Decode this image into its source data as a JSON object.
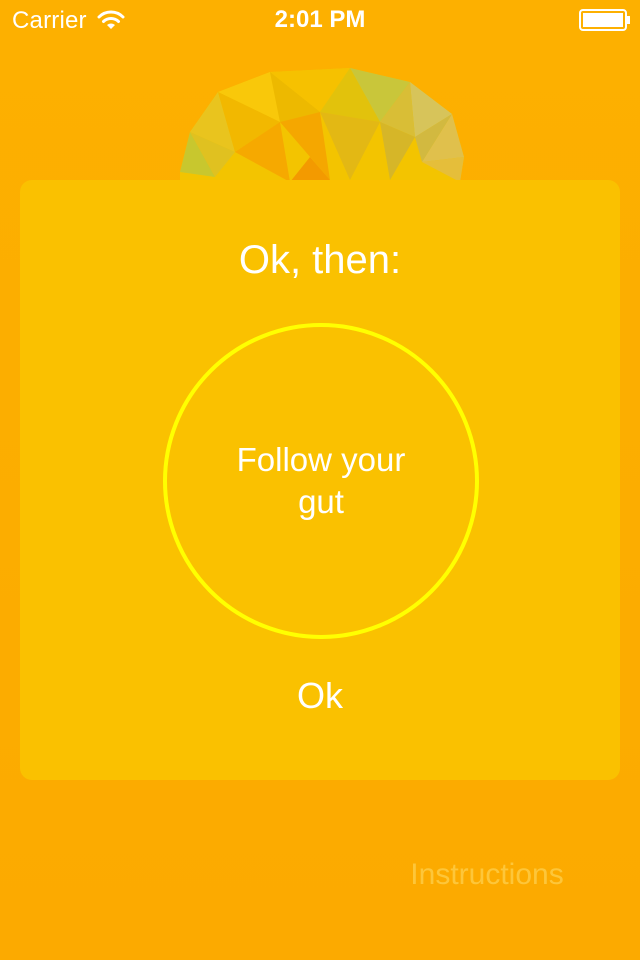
{
  "status_bar": {
    "carrier": "Carrier",
    "time": "2:01 PM",
    "wifi_icon": "wifi-icon",
    "battery_icon": "battery-icon"
  },
  "dialog": {
    "title": "Ok, then:",
    "answer": "Follow your gut",
    "ok_label": "Ok"
  },
  "footer": {
    "instructions_label": "Instructions"
  },
  "colors": {
    "background": "#FCAE00",
    "dialog": "#FAC100",
    "circle_stroke": "#FFFF00",
    "text": "#FFFFFF",
    "instructions_text": "#FDC63A"
  }
}
